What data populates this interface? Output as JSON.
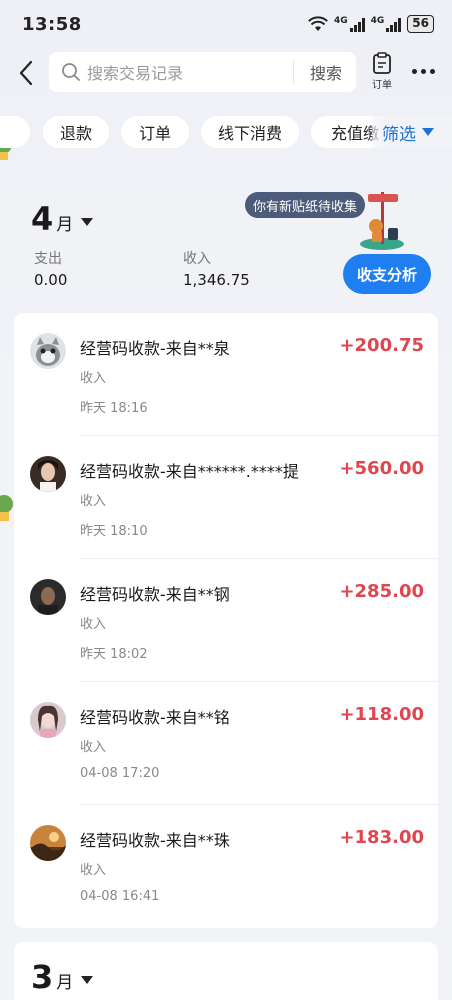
{
  "status_bar": {
    "time": "13:58",
    "signal1_label": "4G",
    "signal2_label": "4G",
    "battery": "56"
  },
  "header": {
    "search_placeholder": "搜索交易记录",
    "search_button": "搜索",
    "order_label": "订单"
  },
  "chips": [
    {
      "label": "退款"
    },
    {
      "label": "订单"
    },
    {
      "label": "线下消费"
    },
    {
      "label": "充值缴"
    }
  ],
  "filter_label": "筛选",
  "summary": {
    "month": "4",
    "month_unit": "月",
    "expense_label": "支出",
    "expense_value": "0.00",
    "income_label": "收入",
    "income_value": "1,346.75",
    "sticker_text": "你有新贴纸待收集",
    "analysis_button": "收支分析"
  },
  "transactions": [
    {
      "title": "经营码收款-来自**泉",
      "amount": "+200.75",
      "type": "收入",
      "time": "昨天 18:16",
      "avatar": "cat-avatar"
    },
    {
      "title": "经营码收款-来自******.****提",
      "amount": "+560.00",
      "type": "收入",
      "time": "昨天 18:10",
      "avatar": "person-avatar"
    },
    {
      "title": "经营码收款-来自**钢",
      "amount": "+285.00",
      "type": "收入",
      "time": "昨天 18:02",
      "avatar": "person-avatar"
    },
    {
      "title": "经营码收款-来自**铭",
      "amount": "+118.00",
      "type": "收入",
      "time": "04-08 17:20",
      "avatar": "person-avatar"
    },
    {
      "title": "经营码收款-来自**珠",
      "amount": "+183.00",
      "type": "收入",
      "time": "04-08 16:41",
      "avatar": "landscape-avatar"
    }
  ],
  "next_month": {
    "month": "3",
    "month_unit": "月"
  },
  "colors": {
    "accent": "#1f7ff0",
    "income_red": "#e0464f"
  }
}
